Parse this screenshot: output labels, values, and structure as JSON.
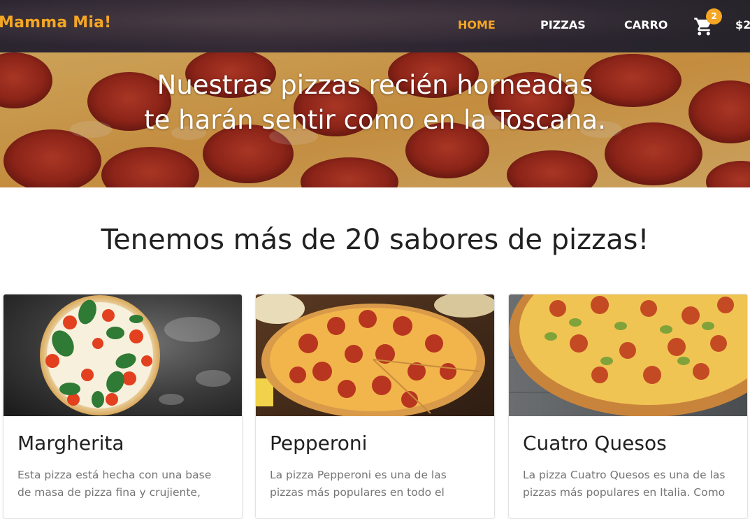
{
  "nav": {
    "brand": "Mamma Mia!",
    "links": [
      {
        "label": "HOME",
        "active": true
      },
      {
        "label": "PIZZAS",
        "active": false
      },
      {
        "label": "CARRO",
        "active": false
      }
    ],
    "cart_count": "2",
    "cart_total": "$2",
    "cart_icon": "shopping-cart-icon"
  },
  "hero": {
    "line1": "Nuestras pizzas recién horneadas",
    "line2": "te harán sentir como en la Toscana."
  },
  "section": {
    "title": "Tenemos más de 20 sabores de pizzas!"
  },
  "cards": [
    {
      "name": "Margherita",
      "description": "Esta pizza está hecha con una base de masa de pizza fina y crujiente,"
    },
    {
      "name": "Pepperoni",
      "description": "La pizza Pepperoni es una de las pizzas más populares en todo el"
    },
    {
      "name": "Cuatro Quesos",
      "description": "La pizza Cuatro Quesos es una de las pizzas más populares en Italia. Como"
    }
  ],
  "colors": {
    "accent": "#f5a623",
    "navbar": "#2b2530",
    "heading": "#212121",
    "body_text": "#757575"
  }
}
